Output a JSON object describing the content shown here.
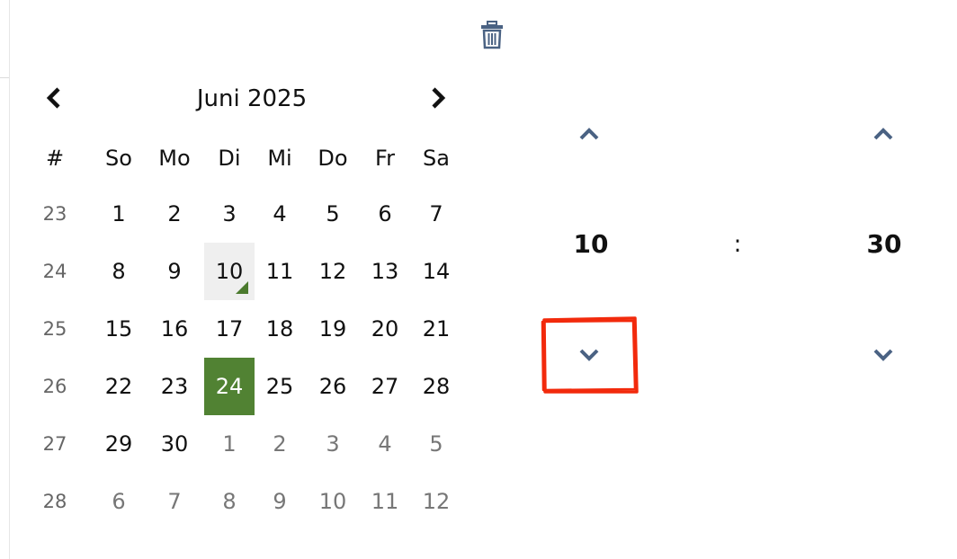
{
  "calendar": {
    "month_label": "Juni 2025",
    "week_header": "#",
    "weekdays": [
      "So",
      "Mo",
      "Di",
      "Mi",
      "Do",
      "Fr",
      "Sa"
    ],
    "weeks": [
      {
        "week": "23",
        "days": [
          "1",
          "2",
          "3",
          "4",
          "5",
          "6",
          "7"
        ]
      },
      {
        "week": "24",
        "days": [
          "8",
          "9",
          "10",
          "11",
          "12",
          "13",
          "14"
        ]
      },
      {
        "week": "25",
        "days": [
          "15",
          "16",
          "17",
          "18",
          "19",
          "20",
          "21"
        ]
      },
      {
        "week": "26",
        "days": [
          "22",
          "23",
          "24",
          "25",
          "26",
          "27",
          "28"
        ]
      },
      {
        "week": "27",
        "days": [
          "29",
          "30",
          "1",
          "2",
          "3",
          "4",
          "5"
        ]
      },
      {
        "week": "28",
        "days": [
          "6",
          "7",
          "8",
          "9",
          "10",
          "11",
          "12"
        ]
      }
    ],
    "today": "10",
    "selected": "24"
  },
  "time": {
    "hours": "10",
    "separator": ":",
    "minutes": "30"
  },
  "colors": {
    "selected_bg": "#518233",
    "today_bg": "#efefef",
    "today_marker": "#4b7a2e",
    "time_chevron": "#4a6283",
    "trash_icon": "#4a6283",
    "highlight": "#f22a0c"
  },
  "icons": {
    "trash": "trash-icon",
    "prev_month": "chevron-left-icon",
    "next_month": "chevron-right-icon",
    "time_up": "chevron-up-icon",
    "time_down": "chevron-down-icon"
  }
}
